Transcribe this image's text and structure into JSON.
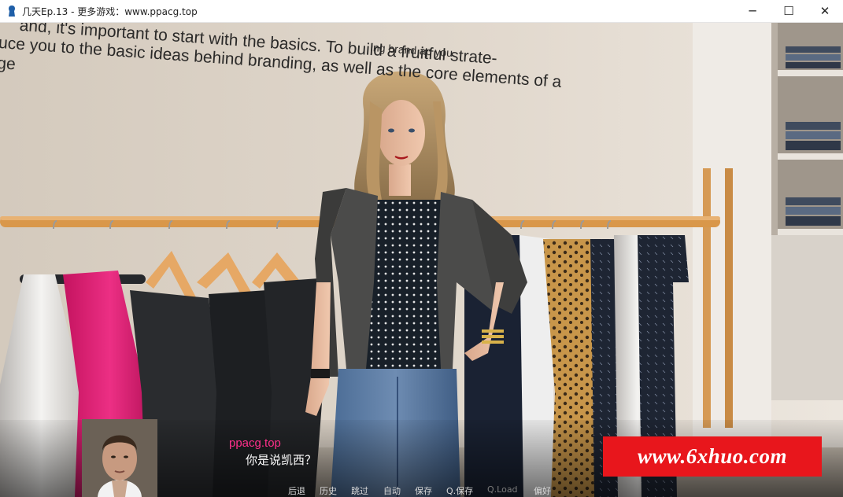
{
  "window": {
    "title": "几天Ep.13 - 更多游戏：www.ppacg.top",
    "controls": {
      "minimize": "─",
      "maximize": "☐",
      "close": "✕"
    }
  },
  "scene": {
    "wall_text_lines": [
      "ing brand                    ap you",
      "uce you to the basic ideas behind branding, as well as the core elements of a",
      "ge"
    ],
    "wall_text_top": "and, it's important to start with the basics. To build a fruitful strate-",
    "characters": [
      "woman-blonde",
      "man-portrait"
    ]
  },
  "dialogue": {
    "speaker": "ppacg.top",
    "text": "你是说凯西？"
  },
  "quick_menu": [
    {
      "label": "后退",
      "enabled": true
    },
    {
      "label": "历史",
      "enabled": true
    },
    {
      "label": "跳过",
      "enabled": true
    },
    {
      "label": "自动",
      "enabled": true
    },
    {
      "label": "保存",
      "enabled": true
    },
    {
      "label": "Q.保存",
      "enabled": true
    },
    {
      "label": "Q.Load",
      "enabled": false
    },
    {
      "label": "偏好",
      "enabled": true
    }
  ],
  "watermark": {
    "text": "www.6xhuo.com",
    "color": "#e8161c"
  },
  "colors": {
    "speaker": "#ff2f8a",
    "dialogue_text": "#ffffff",
    "rack_wood": "#d9974a"
  }
}
